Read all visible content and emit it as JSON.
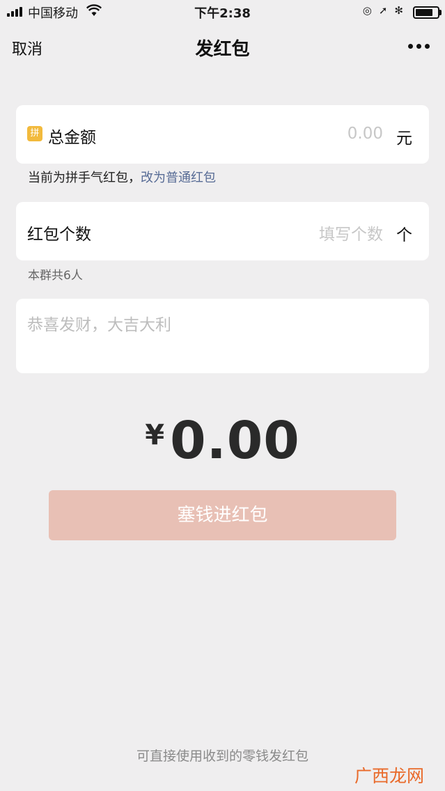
{
  "status_bar": {
    "carrier": "中国移动",
    "time": "下午2:38"
  },
  "nav": {
    "cancel": "取消",
    "title": "发红包"
  },
  "amount_card": {
    "badge": "拼",
    "label": "总金额",
    "value": "0.00",
    "unit": "元"
  },
  "mode_hint": {
    "text": "当前为拼手气红包，",
    "link": "改为普通红包"
  },
  "count_card": {
    "label": "红包个数",
    "placeholder": "填写个数",
    "unit": "个"
  },
  "group_hint": "本群共6人",
  "message": {
    "placeholder": "恭喜发财，大吉大利"
  },
  "total": {
    "currency": "¥",
    "amount": "0.00"
  },
  "submit_button": "塞钱进红包",
  "footer": "可直接使用收到的零钱发红包",
  "watermark": "广西龙网",
  "colors": {
    "background": "#efeeef",
    "button": "#e8c0b5",
    "link": "#576b95",
    "badge": "#f2ba3d"
  }
}
